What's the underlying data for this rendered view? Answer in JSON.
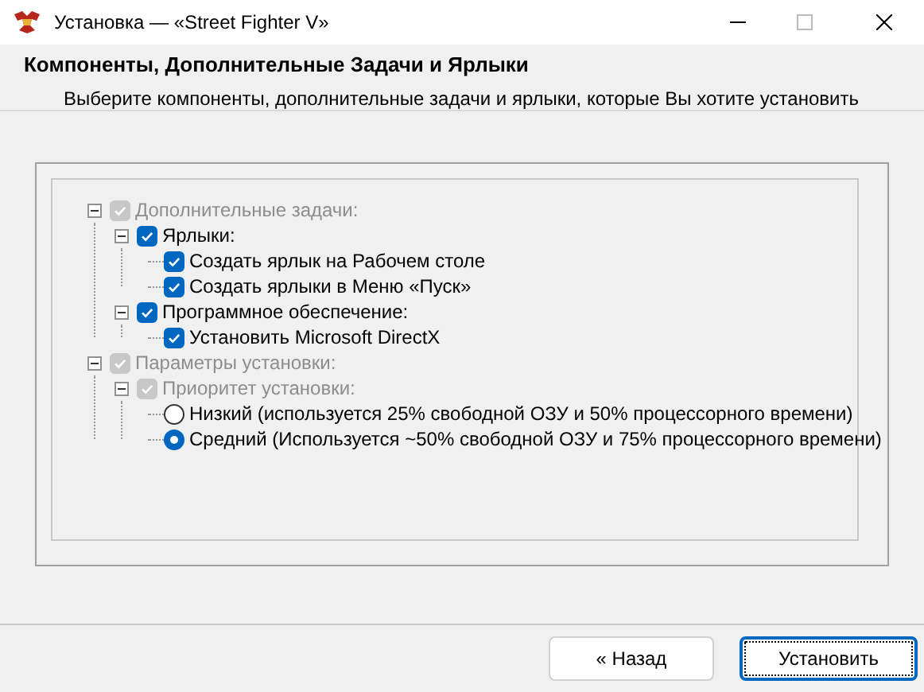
{
  "window": {
    "title": "Установка — «Street Fighter V»"
  },
  "header": {
    "title": "Компоненты, Дополнительные Задачи и Ярлыки",
    "subtitle": "Выберите компоненты, дополнительные задачи и ярлыки, которые Вы хотите установить"
  },
  "tree": [
    {
      "kind": "checkbox",
      "label": "Дополнительные задачи:",
      "checked": true,
      "disabled": true,
      "expanded": true,
      "children": [
        {
          "kind": "checkbox",
          "label": "Ярлыки:",
          "checked": true,
          "disabled": false,
          "expanded": true,
          "children": [
            {
              "kind": "checkbox",
              "label": "Создать ярлык на Рабочем столе",
              "checked": true,
              "disabled": false
            },
            {
              "kind": "checkbox",
              "label": "Создать ярлыки в Меню «Пуск»",
              "checked": true,
              "disabled": false
            }
          ]
        },
        {
          "kind": "checkbox",
          "label": "Программное обеспечение:",
          "checked": true,
          "disabled": false,
          "expanded": true,
          "children": [
            {
              "kind": "checkbox",
              "label": "Установить Microsoft DirectX",
              "checked": true,
              "disabled": false
            }
          ]
        }
      ]
    },
    {
      "kind": "checkbox",
      "label": "Параметры установки:",
      "checked": true,
      "disabled": true,
      "expanded": true,
      "children": [
        {
          "kind": "checkbox",
          "label": "Приоритет установки:",
          "checked": true,
          "disabled": true,
          "expanded": true,
          "children": [
            {
              "kind": "radio",
              "label": "Низкий (используется 25% свободной ОЗУ и 50% процессорного времени)",
              "selected": false,
              "disabled": false
            },
            {
              "kind": "radio",
              "label": "Средний (Используется ~50% свободной ОЗУ и 75% процессорного времени)",
              "selected": true,
              "disabled": false
            }
          ]
        }
      ]
    }
  ],
  "buttons": [
    {
      "label": "« Назад",
      "focused": false
    },
    {
      "label": "Установить",
      "focused": true
    }
  ]
}
